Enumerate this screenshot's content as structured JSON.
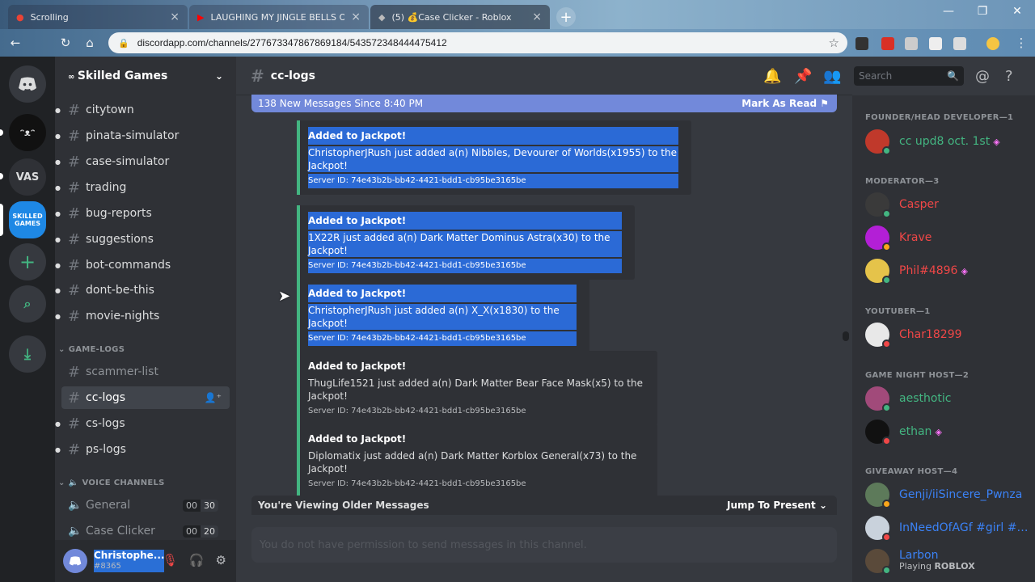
{
  "browser": {
    "tabs": [
      {
        "label": "Scrolling"
      },
      {
        "label": "LAUGHING MY JINGLE BELLS OF"
      },
      {
        "label": "(5) 💰Case Clicker - Roblox"
      }
    ],
    "url": "discordapp.com/channels/277673347867869184/543572348444475412"
  },
  "server": {
    "name": "Skilled Games",
    "channels": [
      {
        "name": "citytown"
      },
      {
        "name": "pinata-simulator"
      },
      {
        "name": "case-simulator"
      },
      {
        "name": "trading"
      },
      {
        "name": "bug-reports"
      },
      {
        "name": "suggestions"
      },
      {
        "name": "bot-commands"
      },
      {
        "name": "dont-be-this"
      },
      {
        "name": "movie-nights"
      }
    ],
    "game_logs_category": "GAME-LOGS",
    "game_logs": [
      {
        "name": "scammer-list"
      },
      {
        "name": "cc-logs"
      },
      {
        "name": "cs-logs"
      },
      {
        "name": "ps-logs"
      }
    ],
    "voice_category": "VOICE CHANNELS",
    "voice": [
      {
        "name": "General",
        "count_a": "00",
        "count_b": "30"
      },
      {
        "name": "Case Clicker",
        "count_a": "00",
        "count_b": "20"
      }
    ]
  },
  "guilds": {
    "vas_label": "VAS",
    "skilled_label": "SKILLED GAMES"
  },
  "user": {
    "name": "Christophe...",
    "tag": "#8365"
  },
  "chat": {
    "channel": "cc-logs",
    "new_messages": "138 New Messages Since 8:40 PM",
    "mark_as_read": "Mark As Read",
    "messages": [
      {
        "title": "Added to Jackpot!",
        "desc": "ChristopherJRush just added a(n) Nibbles, Devourer of Worlds(x1955) to the Jackpot!",
        "footer": "Server ID: 74e43b2b-bb42-4421-bdd1-cb95be3165be"
      },
      {
        "title": "Added to Jackpot!",
        "desc": "1X22R just added a(n) Dark Matter Dominus Astra(x30) to the Jackpot!",
        "footer": "Server ID: 74e43b2b-bb42-4421-bdd1-cb95be3165be"
      },
      {
        "title": "Added to Jackpot!",
        "desc": "ChristopherJRush just added a(n) X_X(x1830) to the Jackpot!",
        "footer": "Server ID: 74e43b2b-bb42-4421-bdd1-cb95be3165be"
      },
      {
        "title": "Added to Jackpot!",
        "desc": "ThugLife1521 just added a(n) Dark Matter Bear Face Mask(x5) to the Jackpot!",
        "footer": "Server ID: 74e43b2b-bb42-4421-bdd1-cb95be3165be"
      },
      {
        "title": "Added to Jackpot!",
        "desc": "Diplomatix just added a(n) Dark Matter Korblox General(x73) to the Jackpot!",
        "footer": "Server ID: 74e43b2b-bb42-4421-bdd1-cb95be3165be"
      }
    ],
    "older_messages": "You're Viewing Older Messages",
    "jump_to_present": "Jump To Present",
    "composer_placeholder": "You do not have permission to send messages in this channel."
  },
  "search": {
    "placeholder": "Search"
  },
  "members": {
    "roles": [
      {
        "label": "FOUNDER/HEAD DEVELOPER—1"
      },
      {
        "label": "MODERATOR—3"
      },
      {
        "label": "YOUTUBER—1"
      },
      {
        "label": "GAME NIGHT HOST—2"
      },
      {
        "label": "GIVEAWAY HOST—4"
      }
    ],
    "list": [
      {
        "name": "cc upd8 oct. 1st",
        "color": "#43b581"
      },
      {
        "name": "Casper",
        "color": "#f04747"
      },
      {
        "name": "Krave",
        "color": "#f04747"
      },
      {
        "name": "Phil#4896",
        "color": "#f04747"
      },
      {
        "name": "Char18299",
        "color": "#f04747"
      },
      {
        "name": "aesthotic",
        "color": "#43b581"
      },
      {
        "name": "ethan",
        "color": "#43b581"
      },
      {
        "name": "Genji/iiSincere_Pwnza",
        "color": "#3b82f6"
      },
      {
        "name": "InNeedOfAGf #girl #n...",
        "color": "#3b82f6"
      },
      {
        "name": "Larbon",
        "color": "#3b82f6",
        "activity_prefix": "Playing ",
        "activity": "ROBLOX"
      }
    ]
  }
}
